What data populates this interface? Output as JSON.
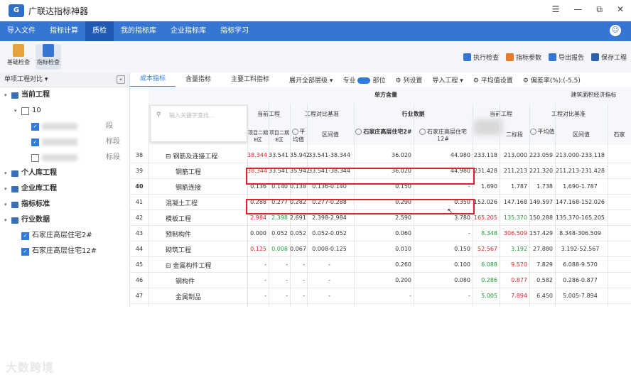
{
  "app": {
    "title": "广联达指标神器"
  },
  "window_buttons": [
    "☰",
    "—",
    "⧉",
    "✕"
  ],
  "menubar": {
    "items": [
      "导入文件",
      "指标计算",
      "质检",
      "我的指标库",
      "企业指标库",
      "指标学习"
    ],
    "active_index": 2
  },
  "toolbar": {
    "left": [
      {
        "label": "基础检查",
        "icon": "check-doc-icon"
      },
      {
        "label": "指标检查",
        "icon": "index-check-icon"
      }
    ],
    "right": [
      {
        "label": "执行检查",
        "icon": "run-icon"
      },
      {
        "label": "指标参数",
        "icon": "param-icon"
      },
      {
        "label": "导出报告",
        "icon": "export-icon"
      },
      {
        "label": "保存工程",
        "icon": "save-icon"
      }
    ]
  },
  "leftpanel": {
    "header": "单项工程对比 ▾",
    "tree": [
      {
        "label": "当前工程",
        "level": 0,
        "type": "folder",
        "bold": true
      },
      {
        "label": "10",
        "level": 1,
        "type": "check",
        "checked": false
      },
      {
        "label": "段",
        "level": 2,
        "type": "check",
        "checked": true
      },
      {
        "label": "标段",
        "level": 2,
        "type": "check",
        "checked": true
      },
      {
        "label": "标段",
        "level": 2,
        "type": "check",
        "checked": false
      },
      {
        "label": "个人库工程",
        "level": 0,
        "type": "folder",
        "bold": true
      },
      {
        "label": "企业库工程",
        "level": 0,
        "type": "folder",
        "bold": true
      },
      {
        "label": "指标标准",
        "level": 0,
        "type": "folder",
        "bold": true
      },
      {
        "label": "行业数据",
        "level": 0,
        "type": "folder",
        "bold": true
      },
      {
        "label": "石家庄高层住宅2#",
        "level": 1,
        "type": "check",
        "checked": true
      },
      {
        "label": "石家庄高层住宅12#",
        "level": 1,
        "type": "check",
        "checked": true
      }
    ]
  },
  "tabs": {
    "items": [
      "成本指标",
      "含量指标",
      "主要工料指标"
    ],
    "active_index": 0,
    "options": [
      "展开全部层级 ▾",
      "专业",
      "部位",
      "列设置",
      "导入工程 ▾",
      "平均值设置",
      "偏差率(%):(-5,5)"
    ]
  },
  "search": {
    "placeholder": "输入关键字查找..."
  },
  "grid": {
    "group_header": "单方含量",
    "group_header_right": "建筑面积经济指标",
    "col_groups": [
      "当前工程",
      "工程对比基准",
      "行业数据",
      "当前工程",
      "工程对比基准"
    ],
    "sub_headers": [
      "项目二期E区",
      "项目二期E区",
      "平均值",
      "区间值",
      "石家庄高层住宅2#",
      "石家庄高层住宅12#",
      "二标段",
      "平均值",
      "区间值",
      "石家"
    ],
    "rows": [
      {
        "num": "38",
        "name": "钢筋及连接工程",
        "indent": 1,
        "box": "⊟",
        "v": [
          "38.344",
          "33.541",
          "35.942",
          "33.541-38.344",
          "36.020",
          "44.980",
          "233.118",
          "213.000",
          "223.059",
          "213.000-233.118"
        ],
        "red": [
          0
        ]
      },
      {
        "num": "39",
        "name": "钢筋工程",
        "indent": 2,
        "v": [
          "38.344",
          "33.541",
          "35.942",
          "33.541-38.344",
          "36.020",
          "44.980",
          "231.428",
          "211.213",
          "221.320",
          "211.213-231.428"
        ],
        "red": [
          0
        ]
      },
      {
        "num": "40",
        "name": "钢筋连接",
        "indent": 2,
        "v": [
          "0.136",
          "0.140",
          "0.138",
          "0.136-0.140",
          "0.150",
          "-",
          "1.690",
          "1.787",
          "1.738",
          "1.690-1.787"
        ],
        "red": []
      },
      {
        "num": "41",
        "name": "混凝土工程",
        "indent": 1,
        "v": [
          "0.288",
          "0.277",
          "0.282",
          "0.277-0.288",
          "0.290",
          "0.350",
          "152.026",
          "147.168",
          "149.597",
          "147.168-152.026"
        ],
        "red": []
      },
      {
        "num": "42",
        "name": "模板工程",
        "indent": 1,
        "v": [
          "2.984",
          "2.398",
          "2.691",
          "2.398-2.984",
          "2.590",
          "3.780",
          "165.205",
          "135.370",
          "150.288",
          "135.370-165.205"
        ],
        "red": [
          0,
          6
        ],
        "green": [
          1,
          7
        ]
      },
      {
        "num": "43",
        "name": "预制构件",
        "indent": 1,
        "v": [
          "0.000",
          "0.052",
          "0.052",
          "0.052-0.052",
          "0.060",
          "-",
          "8.348",
          "306.509",
          "157.429",
          "8.348-306.509"
        ],
        "red": [
          7
        ],
        "green": [
          6
        ]
      },
      {
        "num": "44",
        "name": "砌筑工程",
        "indent": 1,
        "v": [
          "0.125",
          "0.008",
          "0.067",
          "0.008-0.125",
          "0.010",
          "0.150",
          "52.567",
          "3.192",
          "27.880",
          "3.192-52.567"
        ],
        "red": [
          0,
          6
        ],
        "green": [
          1,
          7
        ]
      },
      {
        "num": "45",
        "name": "金属构件工程",
        "indent": 1,
        "box": "⊟",
        "v": [
          "-",
          "-",
          "-",
          "-",
          "0.260",
          "0.100",
          "6.088",
          "9.570",
          "7.829",
          "6.088-9.570"
        ],
        "red": [
          7
        ],
        "green": [
          6
        ]
      },
      {
        "num": "46",
        "name": "钢构件",
        "indent": 2,
        "v": [
          "-",
          "-",
          "-",
          "-",
          "0.200",
          "0.080",
          "0.286",
          "0.877",
          "0.582",
          "0.286-0.877"
        ],
        "red": [
          7
        ],
        "green": [
          6
        ]
      },
      {
        "num": "47",
        "name": "金属制品",
        "indent": 2,
        "v": [
          "-",
          "-",
          "-",
          "-",
          "-",
          "-",
          "5.005",
          "7.894",
          "6.450",
          "5.005-7.894"
        ],
        "red": [
          7
        ],
        "green": [
          6
        ]
      }
    ]
  },
  "watermark": "大数跨境",
  "colors": {
    "accent": "#3575d3",
    "highlight_border": "#e0202a",
    "red": "#e0202a",
    "green": "#1e9b3d"
  }
}
